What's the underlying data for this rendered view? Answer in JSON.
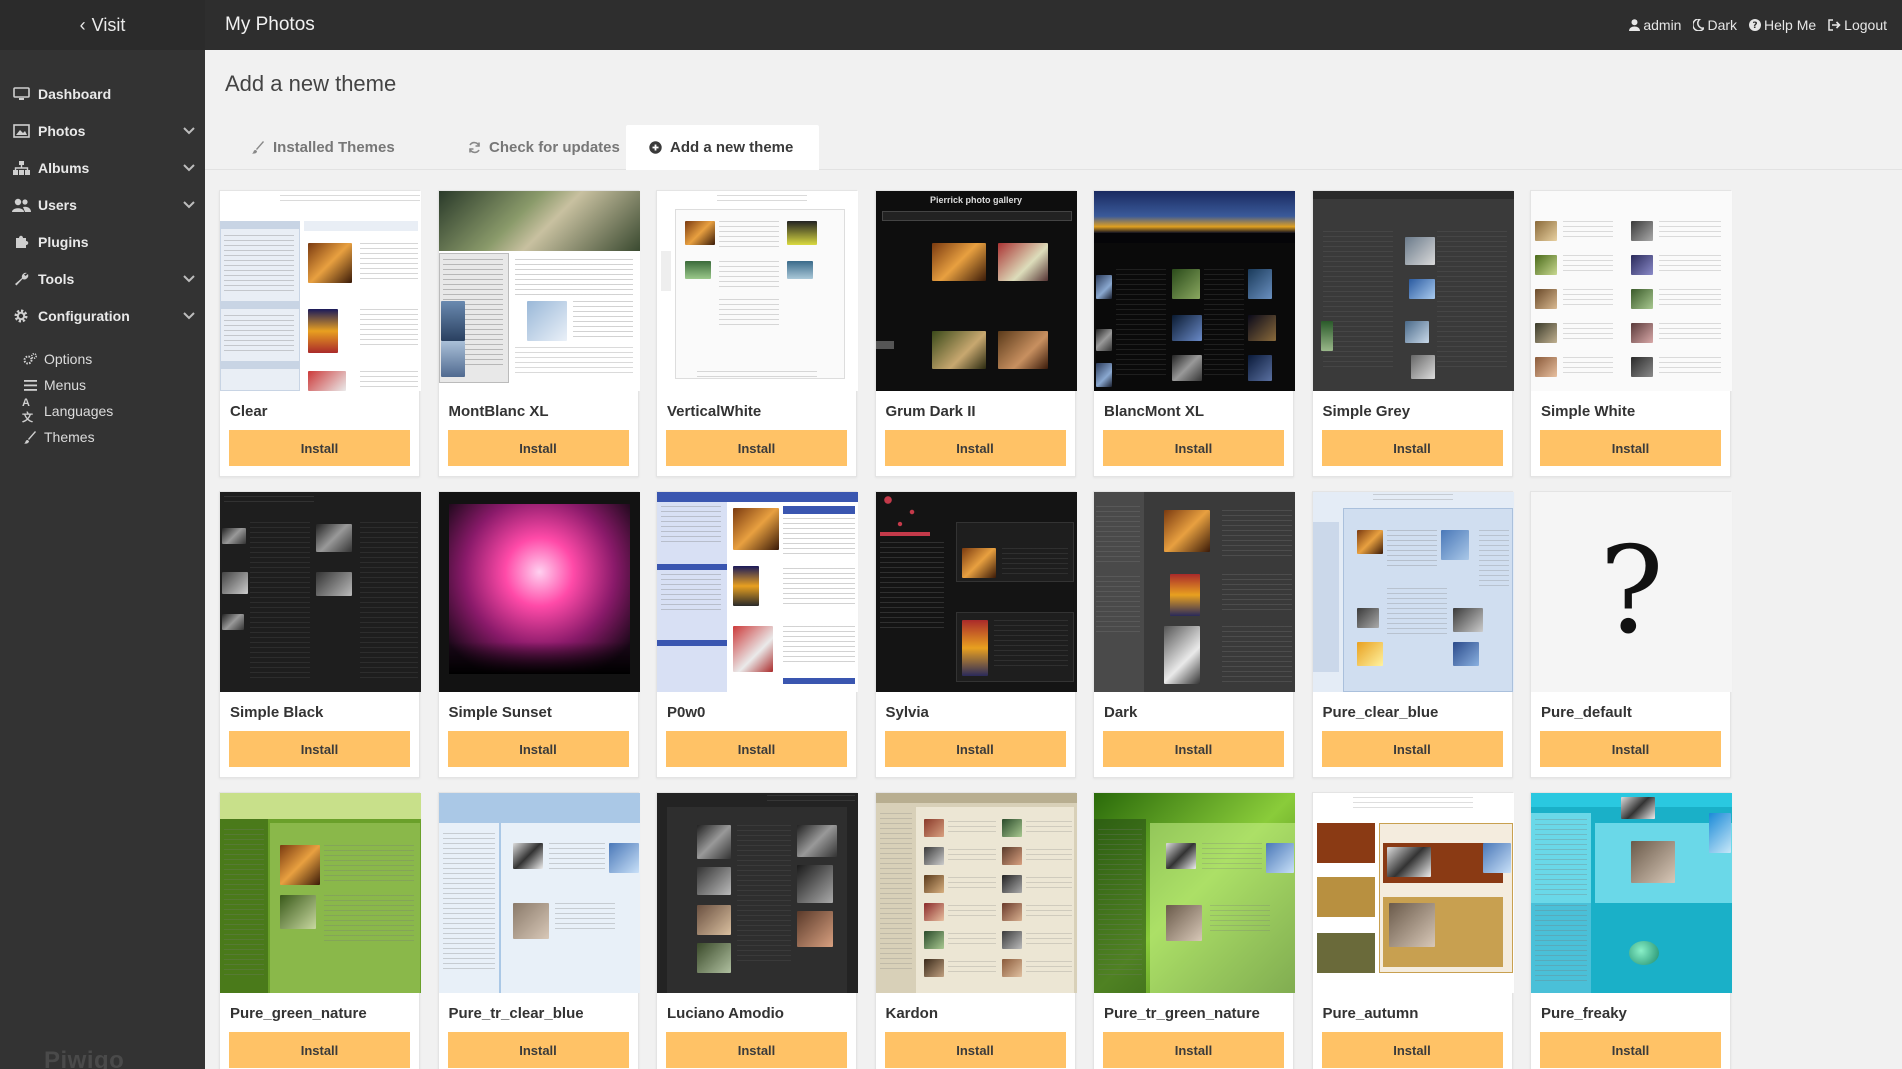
{
  "sidebar": {
    "visit_label": "Visit",
    "items": [
      {
        "label": "Dashboard",
        "icon": "monitor-icon",
        "arrow": false
      },
      {
        "label": "Photos",
        "icon": "image-icon",
        "arrow": true
      },
      {
        "label": "Albums",
        "icon": "sitemap-icon",
        "arrow": true
      },
      {
        "label": "Users",
        "icon": "users-icon",
        "arrow": true
      },
      {
        "label": "Plugins",
        "icon": "puzzle-icon",
        "arrow": false
      },
      {
        "label": "Tools",
        "icon": "wrench-icon",
        "arrow": true
      },
      {
        "label": "Configuration",
        "icon": "cog-icon",
        "arrow": true
      }
    ],
    "subitems": [
      {
        "label": "Options",
        "icon": "cogs-icon"
      },
      {
        "label": "Menus",
        "icon": "list-icon"
      },
      {
        "label": "Languages",
        "icon": "language-icon"
      },
      {
        "label": "Themes",
        "icon": "brush-icon"
      }
    ],
    "logo": "Piwigo"
  },
  "topbar": {
    "title": "My Photos",
    "links": [
      {
        "label": "admin",
        "icon": "user-icon"
      },
      {
        "label": "Dark",
        "icon": "moon-icon"
      },
      {
        "label": "Help Me",
        "icon": "help-icon"
      },
      {
        "label": "Logout",
        "icon": "logout-icon"
      }
    ]
  },
  "page": {
    "title": "Add a new theme",
    "tabs": [
      {
        "label": "Installed Themes",
        "icon": "brush-icon",
        "active": false
      },
      {
        "label": "Check for updates",
        "icon": "refresh-icon",
        "active": false
      },
      {
        "label": "Add a new theme",
        "icon": "plus-circle-icon",
        "active": true
      }
    ],
    "install_label": "Install"
  },
  "themes": [
    {
      "name": "Clear",
      "style": "light",
      "bg": "#ffffff",
      "panel": "#e9eef5",
      "accent": "#3a6ab0"
    },
    {
      "name": "MontBlanc XL",
      "style": "montblanc",
      "bg": "#ffffff",
      "panel": "#3c4a3a",
      "accent": "#5a8fc8"
    },
    {
      "name": "VerticalWhite",
      "style": "vertical",
      "bg": "#ffffff",
      "panel": "#f4f4f4",
      "accent": "#5a8a3a"
    },
    {
      "name": "Grum Dark II",
      "style": "grum",
      "bg": "#121212",
      "panel": "#1f1f1f",
      "accent": "#cccccc"
    },
    {
      "name": "BlancMont XL",
      "style": "blancmont",
      "bg": "#0a0a12",
      "panel": "#1a2a55",
      "accent": "#e0a020"
    },
    {
      "name": "Simple Grey",
      "style": "grey",
      "bg": "#3a3a3a",
      "panel": "#474747",
      "accent": "#aaaaaa"
    },
    {
      "name": "Simple White",
      "style": "white",
      "bg": "#f7f7f7",
      "panel": "#ffffff",
      "accent": "#bbbbbb"
    },
    {
      "name": "Simple Black",
      "style": "black",
      "bg": "#1c1c1c",
      "panel": "#262626",
      "accent": "#777777"
    },
    {
      "name": "Simple Sunset",
      "style": "sunset",
      "bg": "#1a1a1a",
      "panel": "#3a0e2a",
      "accent": "#ff5aa8"
    },
    {
      "name": "P0w0",
      "style": "p0w0",
      "bg": "#ffffff",
      "panel": "#d8e0f4",
      "accent": "#3a56b0"
    },
    {
      "name": "Sylvia",
      "style": "sylvia",
      "bg": "#141414",
      "panel": "#1e1e1e",
      "accent": "#c43a4a"
    },
    {
      "name": "Dark",
      "style": "dark",
      "bg": "#3a3a3a",
      "panel": "#505050",
      "accent": "#d8d8d8"
    },
    {
      "name": "Pure_clear_blue",
      "style": "clearblue",
      "bg": "#e4ecf6",
      "panel": "#c9d9ec",
      "accent": "#4a78b8"
    },
    {
      "name": "Pure_default",
      "style": "unknown",
      "bg": "#f5f5f5",
      "panel": "#f5f5f5",
      "accent": "#111111"
    },
    {
      "name": "Pure_green_nature",
      "style": "greennature",
      "bg": "#5a8a2a",
      "panel": "#8ab84a",
      "accent": "#d6e88a"
    },
    {
      "name": "Pure_tr_clear_blue",
      "style": "trclearblue",
      "bg": "#aac8e6",
      "panel": "#e8f0f8",
      "accent": "#4a78b8"
    },
    {
      "name": "Luciano Amodio",
      "style": "luciano",
      "bg": "#232323",
      "panel": "#2e2e2e",
      "accent": "#8a8a8a"
    },
    {
      "name": "Kardon",
      "style": "kardon",
      "bg": "#d8d0b8",
      "panel": "#ece6d4",
      "accent": "#8a7a4a"
    },
    {
      "name": "Pure_tr_green_nature",
      "style": "trgreen",
      "bg": "#4a8a1a",
      "panel": "#9acc5a",
      "accent": "#d8f0a0"
    },
    {
      "name": "Pure_autumn",
      "style": "autumn",
      "bg": "#ffffff",
      "panel": "#8a3a14",
      "accent": "#c8a050"
    },
    {
      "name": "Pure_freaky",
      "style": "freaky",
      "bg": "#1ab0c8",
      "panel": "#6ad8e8",
      "accent": "#2a2a8a"
    }
  ]
}
